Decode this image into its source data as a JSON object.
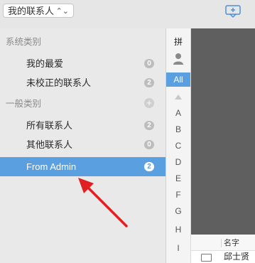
{
  "toolbar": {
    "account_select": "我的联系人",
    "account_chevron": "⌃⌄"
  },
  "sidebar": {
    "section_system": "系统类别",
    "section_general": "一般类别",
    "items": [
      {
        "label": "我的最爱",
        "count": "0"
      },
      {
        "label": "未校正的联系人",
        "count": "2"
      },
      {
        "label": "所有联系人",
        "count": "2"
      },
      {
        "label": "其他联系人",
        "count": "0"
      },
      {
        "label": "From Admin",
        "count": "2",
        "selected": true
      }
    ],
    "add_label": "+"
  },
  "alpha_index": {
    "top_label": "拼",
    "all_label": "All",
    "letters": [
      "A",
      "B",
      "C",
      "D",
      "E",
      "F",
      "G",
      "H",
      "I"
    ]
  },
  "contact_list": {
    "column_name": "名字",
    "first_row_name": "邱士贤"
  },
  "colors": {
    "accent": "#5a9fe0",
    "arrow": "#e02020"
  }
}
